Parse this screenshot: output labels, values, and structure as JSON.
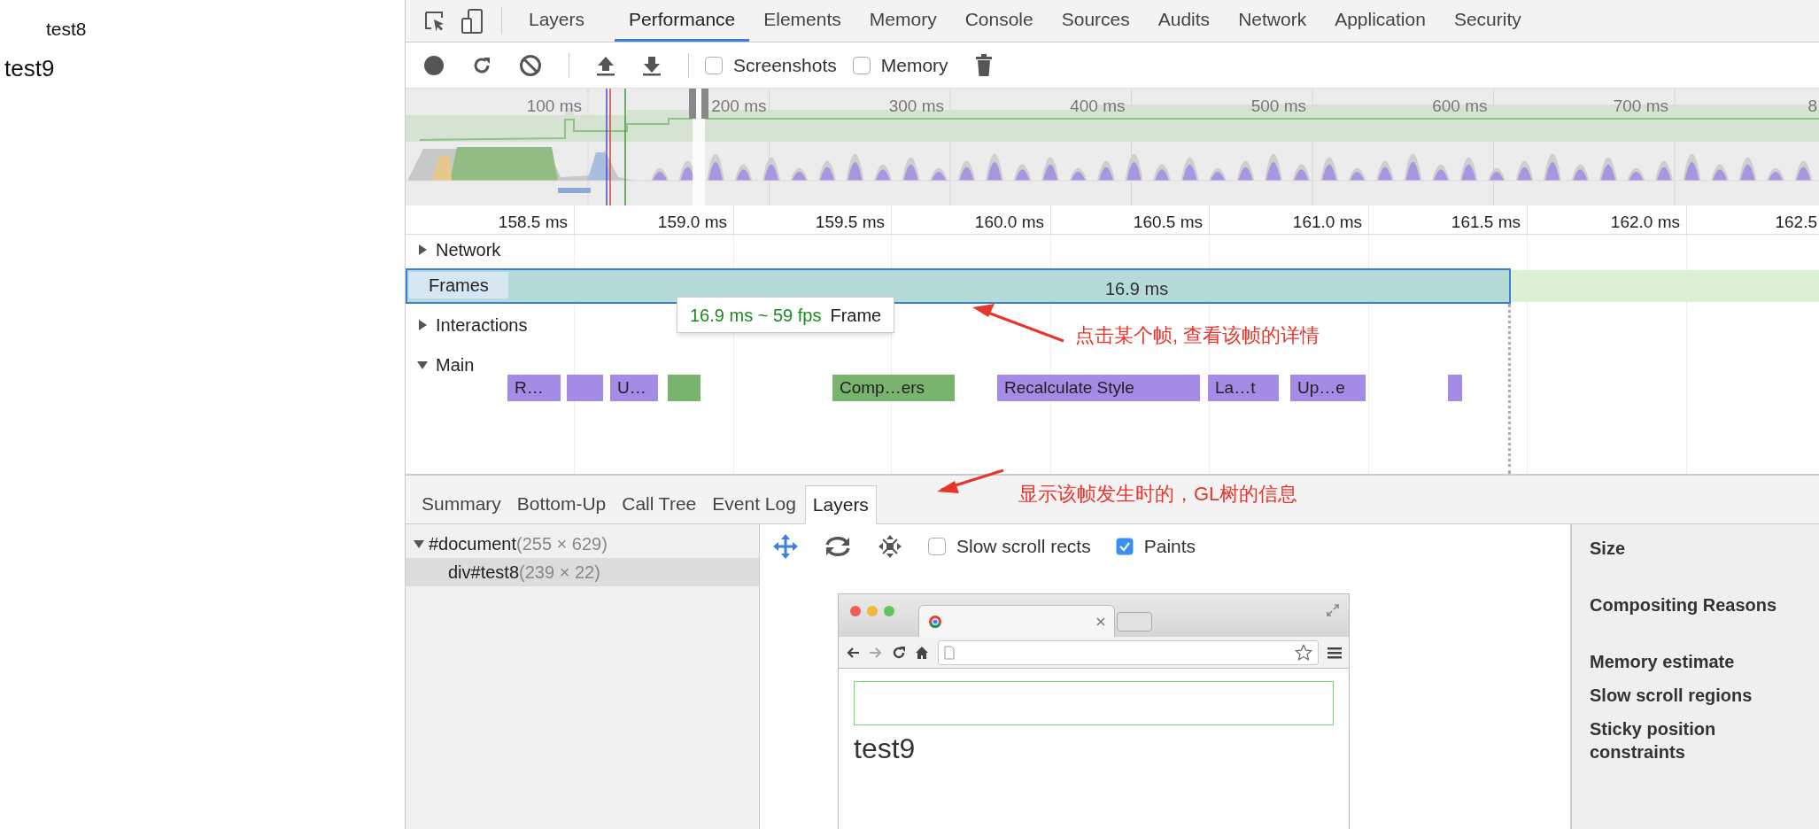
{
  "page": {
    "lines": [
      "test8",
      "test9"
    ]
  },
  "main_tabs": [
    {
      "label": "Layers",
      "selected": false
    },
    {
      "label": "Performance",
      "selected": true
    },
    {
      "label": "Elements",
      "selected": false
    },
    {
      "label": "Memory",
      "selected": false
    },
    {
      "label": "Console",
      "selected": false
    },
    {
      "label": "Sources",
      "selected": false
    },
    {
      "label": "Audits",
      "selected": false
    },
    {
      "label": "Network",
      "selected": false
    },
    {
      "label": "Application",
      "selected": false
    },
    {
      "label": "Security",
      "selected": false
    }
  ],
  "toolbar": {
    "checkboxes": [
      {
        "label": "Screenshots",
        "checked": false
      },
      {
        "label": "Memory",
        "checked": false
      }
    ]
  },
  "overview": {
    "ticks": [
      "100 ms",
      "200 ms",
      "300 ms",
      "400 ms",
      "500 ms",
      "600 ms",
      "700 ms",
      "8"
    ]
  },
  "timeline": {
    "ticks": [
      "158.5 ms",
      "159.0 ms",
      "159.5 ms",
      "160.0 ms",
      "160.5 ms",
      "161.0 ms",
      "161.5 ms",
      "162.0 ms",
      "162.5"
    ],
    "network": {
      "label": "Network",
      "expanded": false
    },
    "frames": {
      "label": "Frames",
      "duration": "16.9 ms",
      "selected": true
    },
    "tooltip": {
      "timing": "16.9 ms ~ 59 fps",
      "label": "Frame"
    },
    "interactions": {
      "label": "Interactions",
      "expanded": false
    },
    "main": {
      "label": "Main",
      "expanded": true
    },
    "main_events": [
      {
        "label": "R…",
        "color": "#a38be6"
      },
      {
        "color": "#a38be6"
      },
      {
        "label": "U…",
        "color": "#a38be6"
      },
      {
        "color": "#79b36e"
      },
      {
        "label": "Comp…ers",
        "color": "#79b36e"
      },
      {
        "label": "Recalculate Style",
        "color": "#a38be6"
      },
      {
        "label": "La…t",
        "color": "#a38be6"
      },
      {
        "label": "Up…e",
        "color": "#a38be6"
      },
      {
        "color": "#a38be6"
      }
    ]
  },
  "annotations": [
    {
      "text": "点击某个帧, 查看该帧的详情"
    },
    {
      "text": "显示该帧发生时的，GL树的信息"
    }
  ],
  "bottom_tabs": [
    {
      "label": "Summary",
      "selected": false
    },
    {
      "label": "Bottom-Up",
      "selected": false
    },
    {
      "label": "Call Tree",
      "selected": false
    },
    {
      "label": "Event Log",
      "selected": false
    },
    {
      "label": "Layers",
      "selected": true
    }
  ],
  "layer_tree": [
    {
      "name": "#document",
      "size": "(255 × 629)",
      "expanded": true,
      "selected": false,
      "children": [
        {
          "name": "div#test8",
          "size": "(239 × 22)",
          "selected": true
        }
      ]
    }
  ],
  "layers_toolbar": {
    "checkboxes": [
      {
        "label": "Slow scroll rects",
        "checked": false
      },
      {
        "label": "Paints",
        "checked": true
      }
    ]
  },
  "preview": {
    "text": "test9"
  },
  "details": {
    "labels": [
      "Size",
      "Compositing Reasons",
      "Memory estimate",
      "Slow scroll regions",
      "Sticky position constraints"
    ]
  }
}
